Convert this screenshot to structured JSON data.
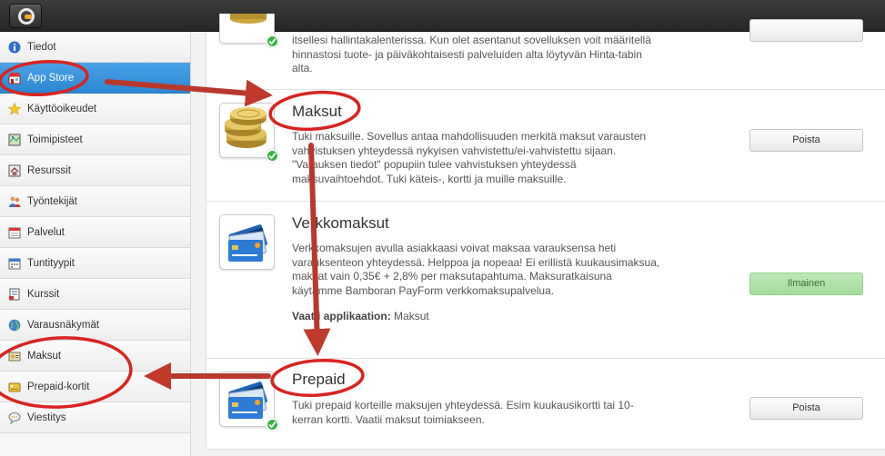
{
  "sidebar": {
    "items": [
      {
        "label": "Tiedot",
        "icon": "info-icon"
      },
      {
        "label": "App Store",
        "icon": "store-icon",
        "active": true
      },
      {
        "label": "Käyttöoikeudet",
        "icon": "star-icon"
      },
      {
        "label": "Toimipisteet",
        "icon": "map-icon"
      },
      {
        "label": "Resurssit",
        "icon": "house-icon"
      },
      {
        "label": "Työntekijät",
        "icon": "people-icon"
      },
      {
        "label": "Palvelut",
        "icon": "calendar-icon"
      },
      {
        "label": "Tuntityypit",
        "icon": "calendar-grid-icon"
      },
      {
        "label": "Kurssit",
        "icon": "course-icon"
      },
      {
        "label": "Varausnäkymät",
        "icon": "globe-icon"
      },
      {
        "label": "Maksut",
        "icon": "money-icon"
      },
      {
        "label": "Prepaid-kortit",
        "icon": "prepaid-card-icon"
      },
      {
        "label": "Viestitys",
        "icon": "chat-icon"
      }
    ]
  },
  "apps": {
    "top": {
      "desc": "itsellesi hallintakalenterissa. Kun olet asentanut sovelluksen voit määritellä hinnastosi tuote- ja päiväkohtaisesti palveluiden alta löytyvän Hinta-tabin alta."
    },
    "maksut": {
      "title": "Maksut",
      "desc": "Tuki maksuille. Sovellus antaa mahdollisuuden merkitä maksut varausten vahvistuksen yhteydessä nykyisen vahvistettu/ei-vahvistettu sijaan. \"Varauksen tiedot\" popupiin tulee vahvistuksen yhteydessä maksuvaihtoehdot. Tuki käteis-, kortti ja muille maksuille.",
      "button": "Poista"
    },
    "verkkomaksut": {
      "title": "Verkkomaksut",
      "desc": "Verkkomaksujen avulla asiakkaasi voivat maksaa varauksensa heti varauksenteon yhteydessä. Helppoa ja nopeaa! Ei erillistä kuukausimaksua, maksat vain 0,35€ + 2,8% per maksutapahtuma. Maksuratkaisuna käytämme Bamboran PayForm verkkomaksupalvelua.",
      "req_label": "Vaatii applikaation:",
      "req_value": " Maksut",
      "button": "Ilmainen"
    },
    "prepaid": {
      "title": "Prepaid",
      "desc": "Tuki prepaid korteille maksujen yhteydessä. Esim kuukausikortti tai 10-kerran kortti. Vaatii maksut toimiakseen.",
      "button": "Poista"
    }
  },
  "colors": {
    "active_nav": "#2c86d1",
    "annotation": "#c0392b",
    "free_button": "#a2dc9a",
    "check": "#35b544"
  }
}
